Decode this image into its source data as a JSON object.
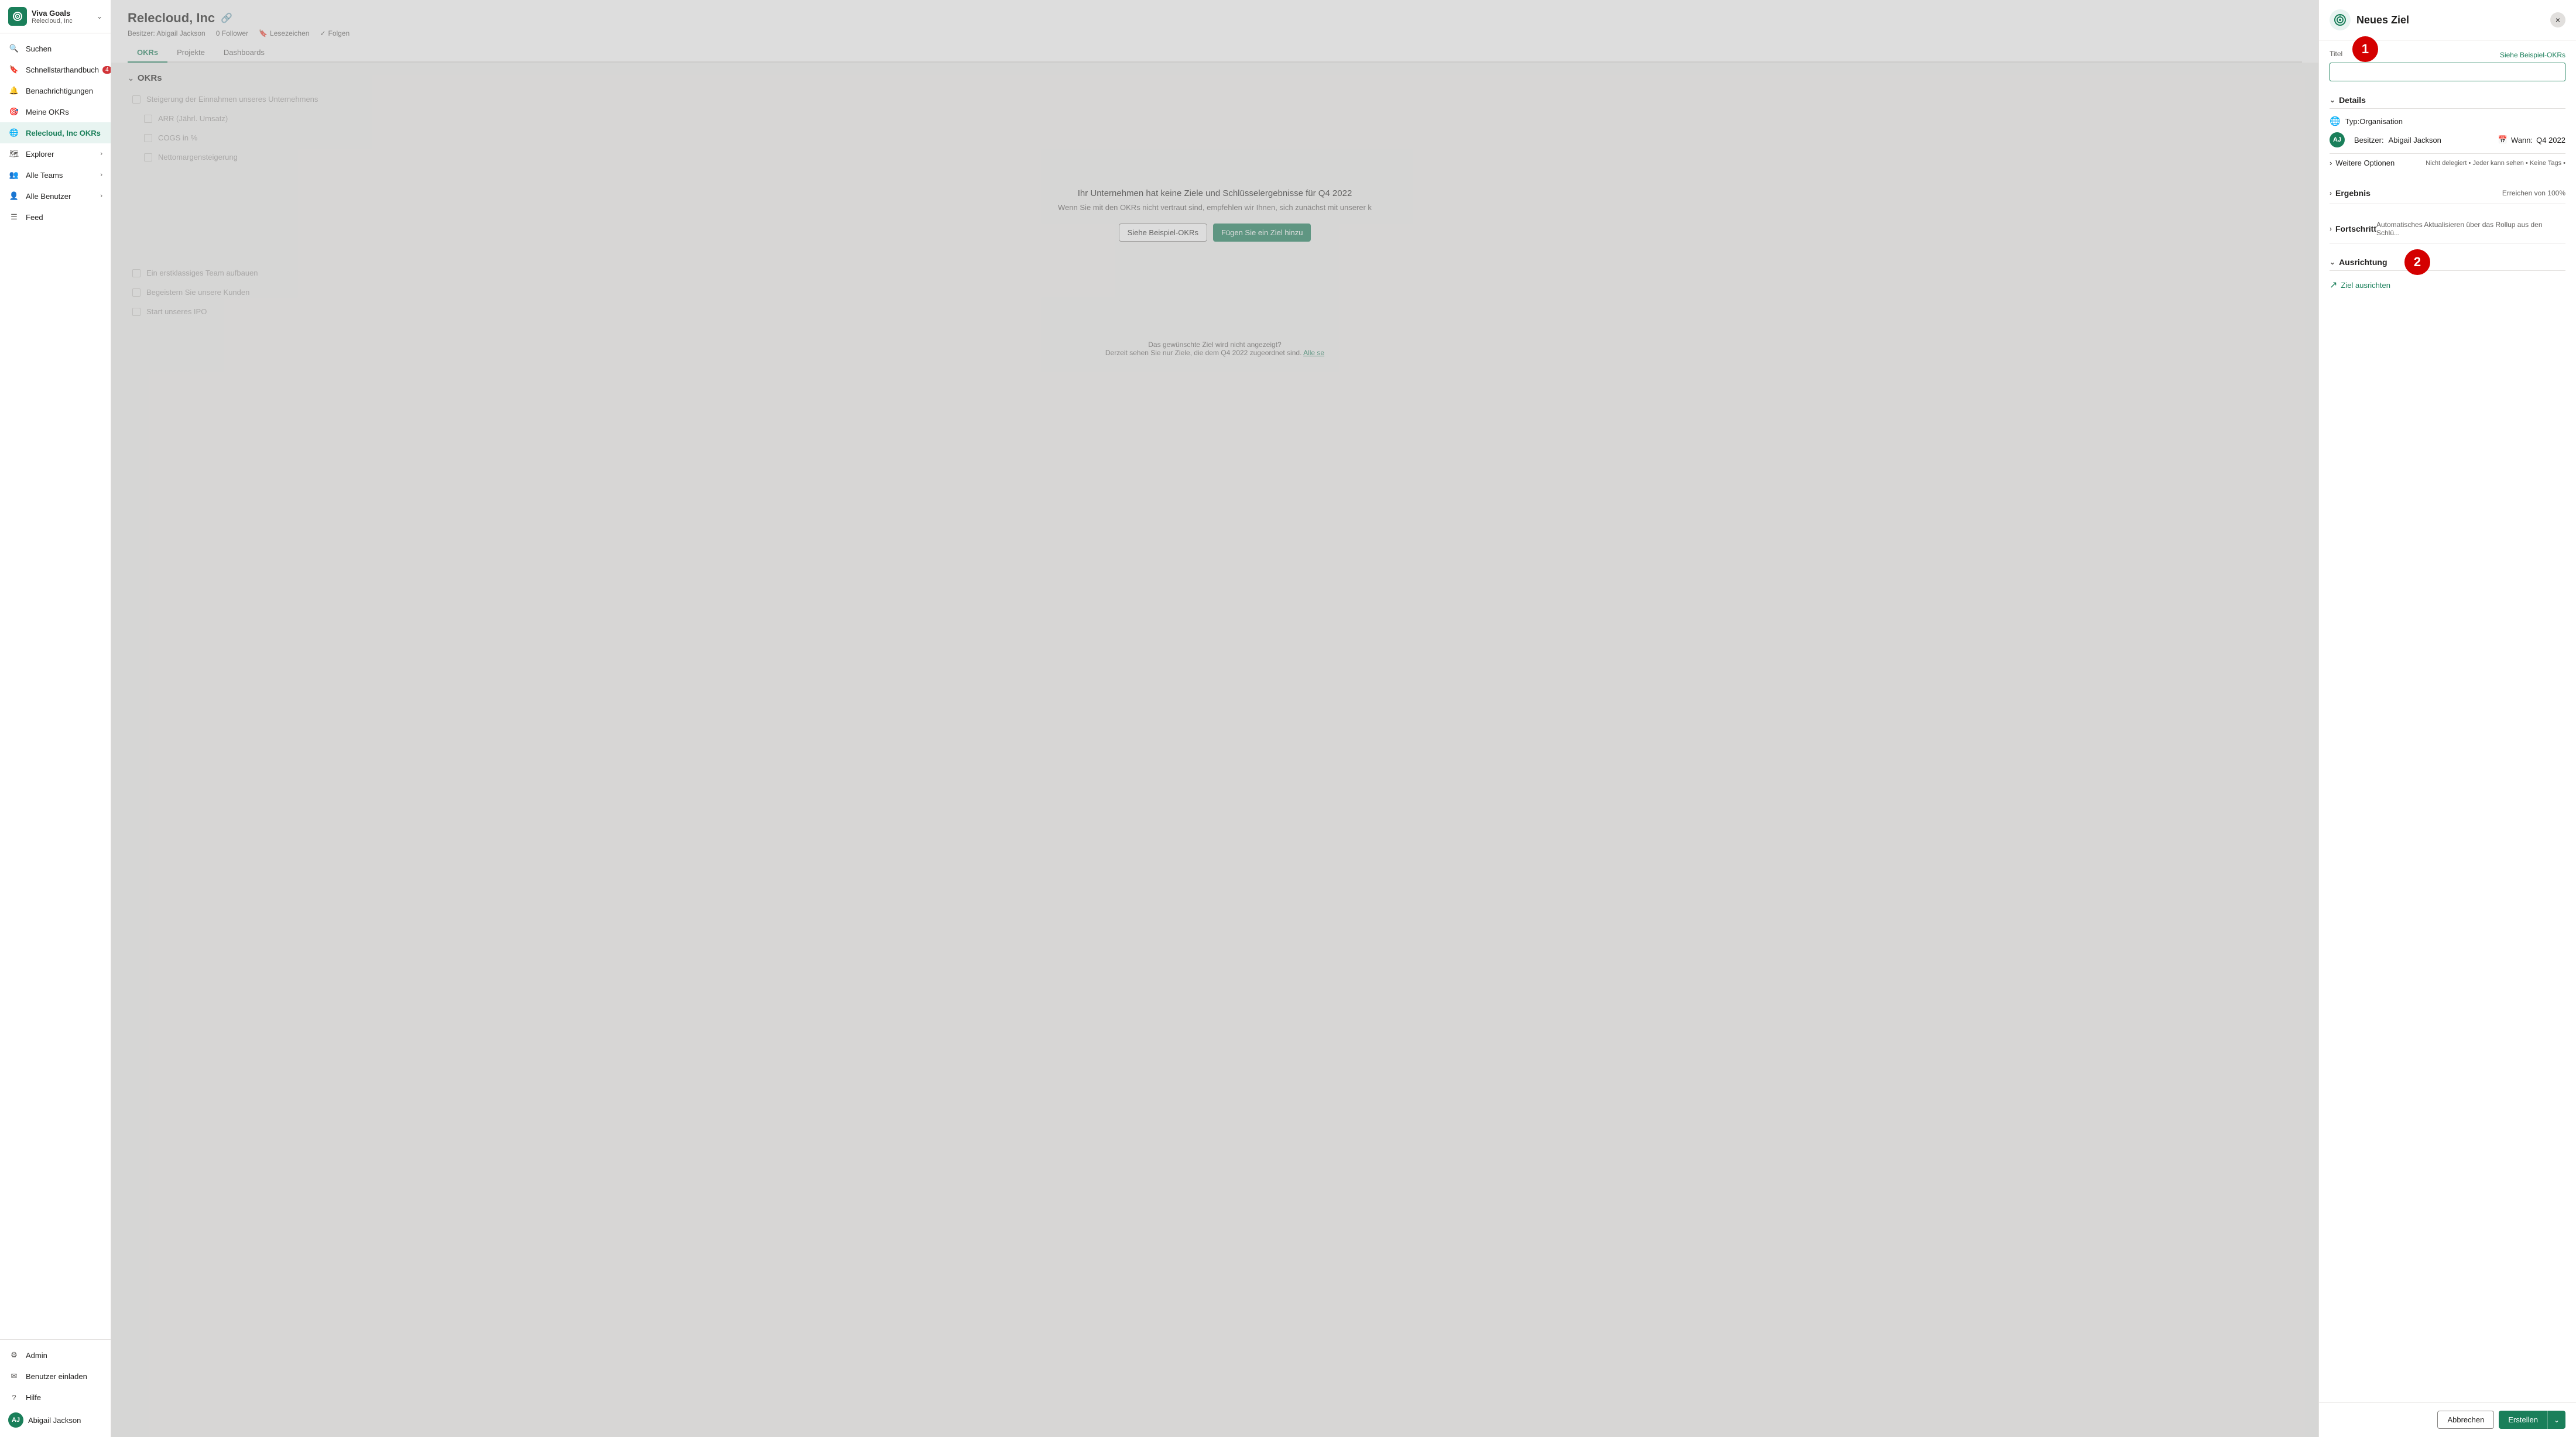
{
  "sidebar": {
    "app_name": "Viva Goals",
    "org_name": "Relecloud, Inc",
    "items": [
      {
        "id": "suchen",
        "label": "Suchen",
        "icon": "search",
        "badge": null,
        "chevron": false
      },
      {
        "id": "schnellstart",
        "label": "Schnellstarthandbuch",
        "icon": "book",
        "badge": "4",
        "chevron": false
      },
      {
        "id": "benachrichtigungen",
        "label": "Benachrichtigungen",
        "icon": "bell",
        "badge": null,
        "chevron": false
      },
      {
        "id": "meine-okrs",
        "label": "Meine OKRs",
        "icon": "target",
        "badge": null,
        "chevron": false
      },
      {
        "id": "relecloud-okrs",
        "label": "Relecloud, Inc OKRs",
        "icon": "globe",
        "badge": null,
        "chevron": false,
        "active": true
      },
      {
        "id": "explorer",
        "label": "Explorer",
        "icon": "compass",
        "badge": null,
        "chevron": true
      },
      {
        "id": "alle-teams",
        "label": "Alle Teams",
        "icon": "people",
        "badge": null,
        "chevron": true
      },
      {
        "id": "alle-benutzer",
        "label": "Alle Benutzer",
        "icon": "person",
        "badge": null,
        "chevron": true
      },
      {
        "id": "feed",
        "label": "Feed",
        "icon": "feed",
        "badge": null,
        "chevron": false
      }
    ],
    "footer_items": [
      {
        "id": "admin",
        "label": "Admin",
        "icon": "settings"
      },
      {
        "id": "benutzer-einladen",
        "label": "Benutzer einladen",
        "icon": "mail"
      },
      {
        "id": "hilfe",
        "label": "Hilfe",
        "icon": "question"
      }
    ],
    "user": {
      "name": "Abigail Jackson",
      "initials": "AJ"
    }
  },
  "main": {
    "company_name": "Relecloud, Inc",
    "owner": "Besitzer: Abigail Jackson",
    "followers": "0 Follower",
    "lesezeichen": "Lesezeichen",
    "folgen": "Folgen",
    "tabs": [
      {
        "id": "okrs",
        "label": "OKRs",
        "active": true
      },
      {
        "id": "projekte",
        "label": "Projekte",
        "active": false
      },
      {
        "id": "dashboards",
        "label": "Dashboards",
        "active": false
      }
    ],
    "section_title": "OKRs",
    "okr_items": [
      {
        "text": "Steigerung der Einnahmen unseres Unternehmens"
      },
      {
        "text": "ARR (Jährl. Umsatz)"
      },
      {
        "text": "COGS in %"
      },
      {
        "text": "Nettomargensteigerung"
      },
      {
        "text": "Ein erstklassiges Team aufbauen"
      },
      {
        "text": "Begeistern Sie unsere Kunden"
      },
      {
        "text": "Start unseres IPO"
      }
    ],
    "empty_state": {
      "title": "Ihr Unternehmen hat keine Ziele und Schlüsselergebnisse für Q4 2022",
      "subtitle": "Wenn Sie mit den OKRs nicht vertraut sind, empfehlen wir Ihnen, sich zunächst mit unserer k",
      "btn_example": "Siehe Beispiel-OKRs",
      "btn_add": "Fügen Sie ein Ziel hinzu"
    },
    "bottom_notice": {
      "text_before": "Das gewünschte Ziel wird nicht angezeigt?",
      "text_sub": "Derzeit sehen Sie nur Ziele, die dem Q4 2022 zugeordnet sind.",
      "link_text": "Alle se"
    }
  },
  "panel": {
    "title": "Neues Ziel",
    "close_label": "×",
    "title_field_label": "Titel",
    "see_example_label": "Siehe Beispiel-OKRs",
    "title_placeholder": "",
    "details_section": "Details",
    "type_label": "Typ:Organisation",
    "owner_label": "Besitzer:",
    "owner_value": "Abigail Jackson",
    "wann_label": "Wann:",
    "wann_value": "Q4 2022",
    "mehr_optionen_label": "Weitere Optionen",
    "mehr_optionen_detail": "Nicht delegiert • Jeder kann sehen • Keine Tags •",
    "ergebnis_section": "Ergebnis",
    "ergebnis_right": "Erreichen von 100%",
    "fortschritt_section": "Fortschritt",
    "fortschritt_right": "Automatisches Aktualisieren über das Rollup aus den Schlü...",
    "ausrichtung_section": "Ausrichtung",
    "ziel_ausrichten_label": "Ziel ausrichten",
    "cancel_label": "Abbrechen",
    "create_label": "Erstellen"
  },
  "annotations": [
    {
      "id": "1",
      "label": "1"
    },
    {
      "id": "2",
      "label": "2"
    }
  ]
}
